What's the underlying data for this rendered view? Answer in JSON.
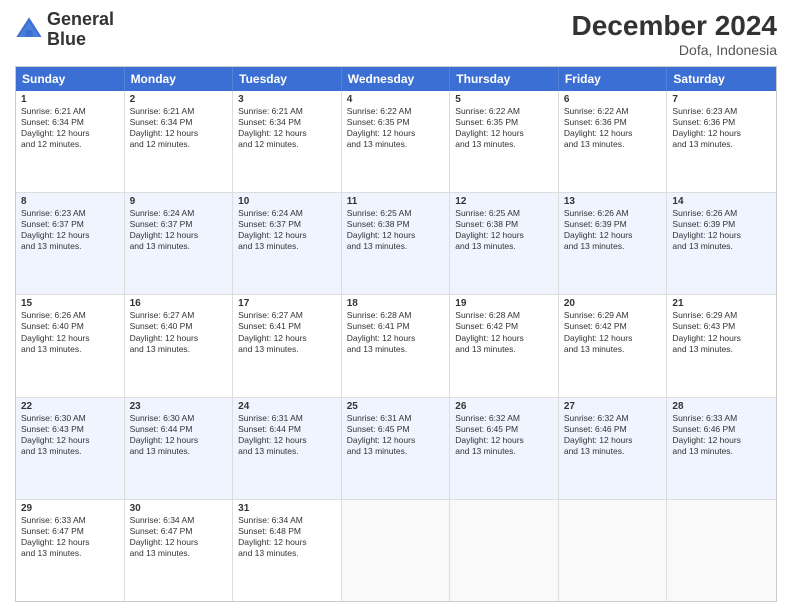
{
  "logo": {
    "line1": "General",
    "line2": "Blue"
  },
  "title": "December 2024",
  "subtitle": "Dofa, Indonesia",
  "headers": [
    "Sunday",
    "Monday",
    "Tuesday",
    "Wednesday",
    "Thursday",
    "Friday",
    "Saturday"
  ],
  "rows": [
    [
      {
        "day": "1",
        "content": "Sunrise: 6:21 AM\nSunset: 6:34 PM\nDaylight: 12 hours\nand 12 minutes."
      },
      {
        "day": "2",
        "content": "Sunrise: 6:21 AM\nSunset: 6:34 PM\nDaylight: 12 hours\nand 12 minutes."
      },
      {
        "day": "3",
        "content": "Sunrise: 6:21 AM\nSunset: 6:34 PM\nDaylight: 12 hours\nand 12 minutes."
      },
      {
        "day": "4",
        "content": "Sunrise: 6:22 AM\nSunset: 6:35 PM\nDaylight: 12 hours\nand 13 minutes."
      },
      {
        "day": "5",
        "content": "Sunrise: 6:22 AM\nSunset: 6:35 PM\nDaylight: 12 hours\nand 13 minutes."
      },
      {
        "day": "6",
        "content": "Sunrise: 6:22 AM\nSunset: 6:36 PM\nDaylight: 12 hours\nand 13 minutes."
      },
      {
        "day": "7",
        "content": "Sunrise: 6:23 AM\nSunset: 6:36 PM\nDaylight: 12 hours\nand 13 minutes."
      }
    ],
    [
      {
        "day": "8",
        "content": "Sunrise: 6:23 AM\nSunset: 6:37 PM\nDaylight: 12 hours\nand 13 minutes."
      },
      {
        "day": "9",
        "content": "Sunrise: 6:24 AM\nSunset: 6:37 PM\nDaylight: 12 hours\nand 13 minutes."
      },
      {
        "day": "10",
        "content": "Sunrise: 6:24 AM\nSunset: 6:37 PM\nDaylight: 12 hours\nand 13 minutes."
      },
      {
        "day": "11",
        "content": "Sunrise: 6:25 AM\nSunset: 6:38 PM\nDaylight: 12 hours\nand 13 minutes."
      },
      {
        "day": "12",
        "content": "Sunrise: 6:25 AM\nSunset: 6:38 PM\nDaylight: 12 hours\nand 13 minutes."
      },
      {
        "day": "13",
        "content": "Sunrise: 6:26 AM\nSunset: 6:39 PM\nDaylight: 12 hours\nand 13 minutes."
      },
      {
        "day": "14",
        "content": "Sunrise: 6:26 AM\nSunset: 6:39 PM\nDaylight: 12 hours\nand 13 minutes."
      }
    ],
    [
      {
        "day": "15",
        "content": "Sunrise: 6:26 AM\nSunset: 6:40 PM\nDaylight: 12 hours\nand 13 minutes."
      },
      {
        "day": "16",
        "content": "Sunrise: 6:27 AM\nSunset: 6:40 PM\nDaylight: 12 hours\nand 13 minutes."
      },
      {
        "day": "17",
        "content": "Sunrise: 6:27 AM\nSunset: 6:41 PM\nDaylight: 12 hours\nand 13 minutes."
      },
      {
        "day": "18",
        "content": "Sunrise: 6:28 AM\nSunset: 6:41 PM\nDaylight: 12 hours\nand 13 minutes."
      },
      {
        "day": "19",
        "content": "Sunrise: 6:28 AM\nSunset: 6:42 PM\nDaylight: 12 hours\nand 13 minutes."
      },
      {
        "day": "20",
        "content": "Sunrise: 6:29 AM\nSunset: 6:42 PM\nDaylight: 12 hours\nand 13 minutes."
      },
      {
        "day": "21",
        "content": "Sunrise: 6:29 AM\nSunset: 6:43 PM\nDaylight: 12 hours\nand 13 minutes."
      }
    ],
    [
      {
        "day": "22",
        "content": "Sunrise: 6:30 AM\nSunset: 6:43 PM\nDaylight: 12 hours\nand 13 minutes."
      },
      {
        "day": "23",
        "content": "Sunrise: 6:30 AM\nSunset: 6:44 PM\nDaylight: 12 hours\nand 13 minutes."
      },
      {
        "day": "24",
        "content": "Sunrise: 6:31 AM\nSunset: 6:44 PM\nDaylight: 12 hours\nand 13 minutes."
      },
      {
        "day": "25",
        "content": "Sunrise: 6:31 AM\nSunset: 6:45 PM\nDaylight: 12 hours\nand 13 minutes."
      },
      {
        "day": "26",
        "content": "Sunrise: 6:32 AM\nSunset: 6:45 PM\nDaylight: 12 hours\nand 13 minutes."
      },
      {
        "day": "27",
        "content": "Sunrise: 6:32 AM\nSunset: 6:46 PM\nDaylight: 12 hours\nand 13 minutes."
      },
      {
        "day": "28",
        "content": "Sunrise: 6:33 AM\nSunset: 6:46 PM\nDaylight: 12 hours\nand 13 minutes."
      }
    ],
    [
      {
        "day": "29",
        "content": "Sunrise: 6:33 AM\nSunset: 6:47 PM\nDaylight: 12 hours\nand 13 minutes."
      },
      {
        "day": "30",
        "content": "Sunrise: 6:34 AM\nSunset: 6:47 PM\nDaylight: 12 hours\nand 13 minutes."
      },
      {
        "day": "31",
        "content": "Sunrise: 6:34 AM\nSunset: 6:48 PM\nDaylight: 12 hours\nand 13 minutes."
      },
      {
        "day": "",
        "content": ""
      },
      {
        "day": "",
        "content": ""
      },
      {
        "day": "",
        "content": ""
      },
      {
        "day": "",
        "content": ""
      }
    ]
  ]
}
